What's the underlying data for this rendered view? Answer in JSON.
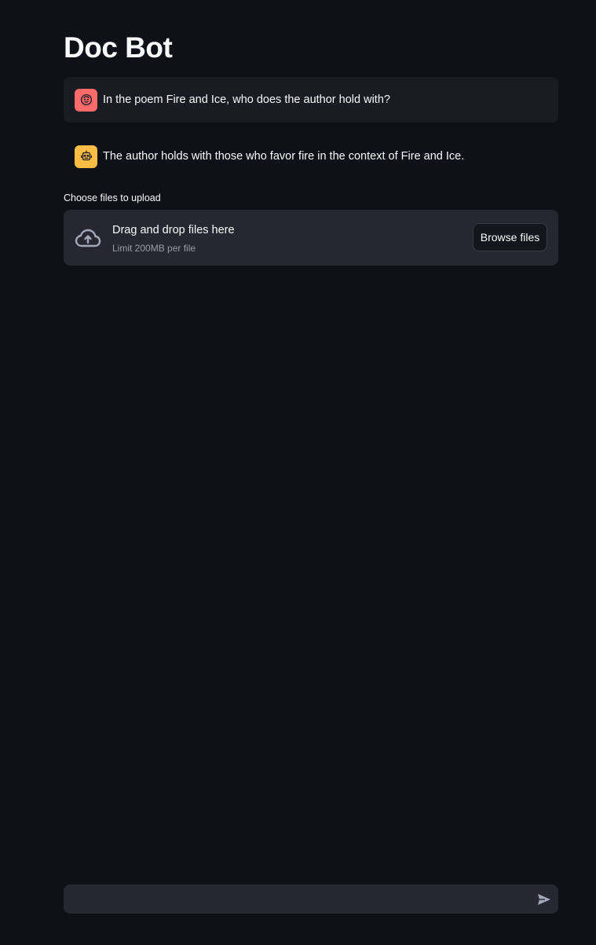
{
  "page": {
    "title": "Doc Bot"
  },
  "chat": {
    "messages": [
      {
        "role": "user",
        "avatar_icon": "smiling-face-icon",
        "avatar_color": "#ff6b6b",
        "text": "In the poem Fire and Ice, who does the author hold with?"
      },
      {
        "role": "assistant",
        "avatar_icon": "robot-icon",
        "avatar_color": "#ffbd45",
        "text": "The author holds with those who favor fire in the context of Fire and Ice."
      }
    ],
    "input_placeholder": "",
    "send_icon": "send-icon"
  },
  "uploader": {
    "label": "Choose files to upload",
    "icon": "cloud-upload-icon",
    "drop_text": "Drag and drop files here",
    "limit_text": "Limit 200MB per file",
    "browse_label": "Browse files"
  },
  "theme": {
    "background": "#0e1117",
    "surface": "#262730",
    "user_message_bg": "#1a1c24",
    "text": "#fafafa"
  }
}
